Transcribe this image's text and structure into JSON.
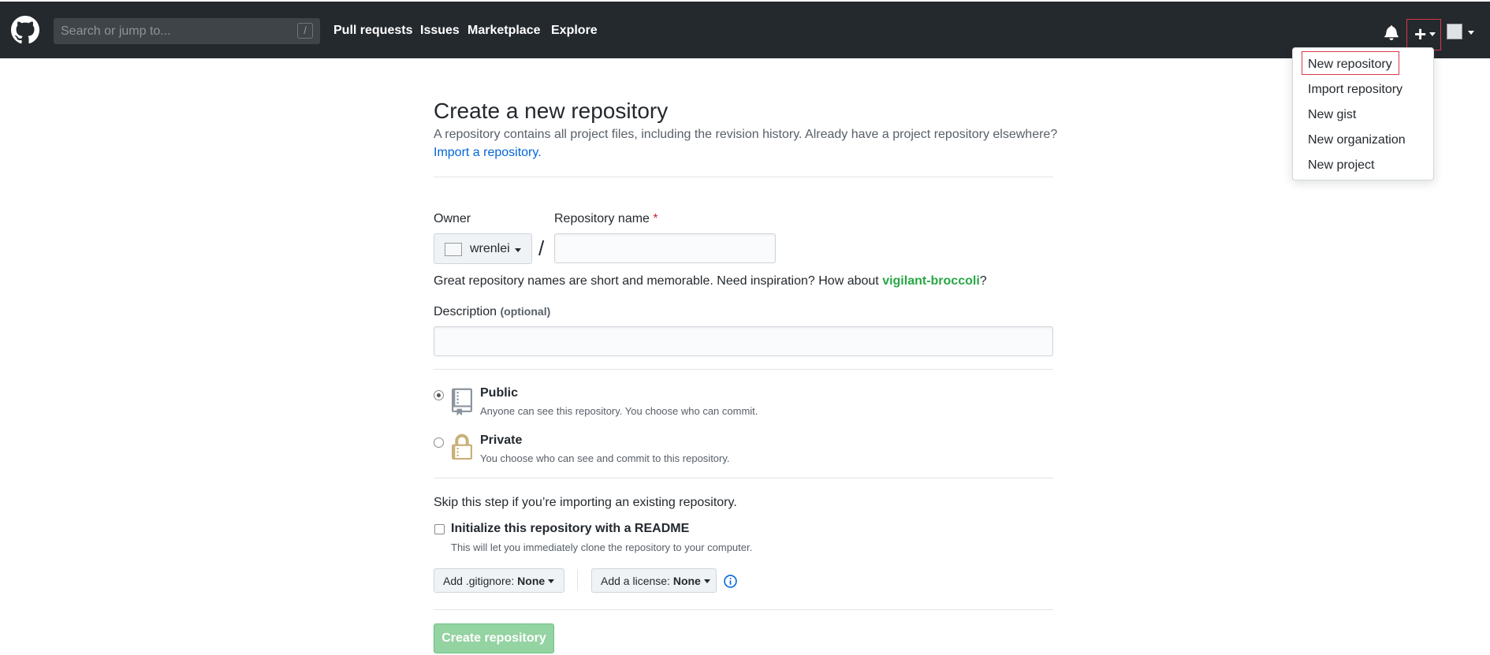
{
  "header": {
    "search_placeholder": "Search or jump to...",
    "search_shortcut": "/",
    "nav": [
      "Pull requests",
      "Issues",
      "Marketplace",
      "Explore"
    ],
    "plus_label": "+"
  },
  "dropdown": {
    "items": [
      "New repository",
      "Import repository",
      "New gist",
      "New organization",
      "New project"
    ]
  },
  "page": {
    "title": "Create a new repository",
    "subtitle": "A repository contains all project files, including the revision history. Already have a project repository elsewhere?",
    "import_link": "Import a repository.",
    "owner_label": "Owner",
    "owner_value": "wrenlei",
    "slash": "/",
    "repo_name_label": "Repository name",
    "required_mark": "*",
    "hint_prefix": "Great repository names are short and memorable. Need inspiration? How about ",
    "hint_suggestion": "vigilant-broccoli",
    "hint_suffix": "?",
    "description_label": "Description",
    "description_optional": "(optional)",
    "public_title": "Public",
    "public_note": "Anyone can see this repository. You choose who can commit.",
    "private_title": "Private",
    "private_note": "You choose who can see and commit to this repository.",
    "skip_text": "Skip this step if you’re importing an existing repository.",
    "init_label": "Initialize this repository with a README",
    "init_note": "This will let you immediately clone the repository to your computer.",
    "gitignore_prefix": "Add .gitignore: ",
    "gitignore_value": "None",
    "license_prefix": "Add a license: ",
    "license_value": "None",
    "create_button": "Create repository"
  },
  "colors": {
    "header_bg": "#24292e",
    "link": "#0366d6",
    "suggestion": "#28a745",
    "create_button": "#94d3a2",
    "highlight_border": "#d73a49"
  }
}
